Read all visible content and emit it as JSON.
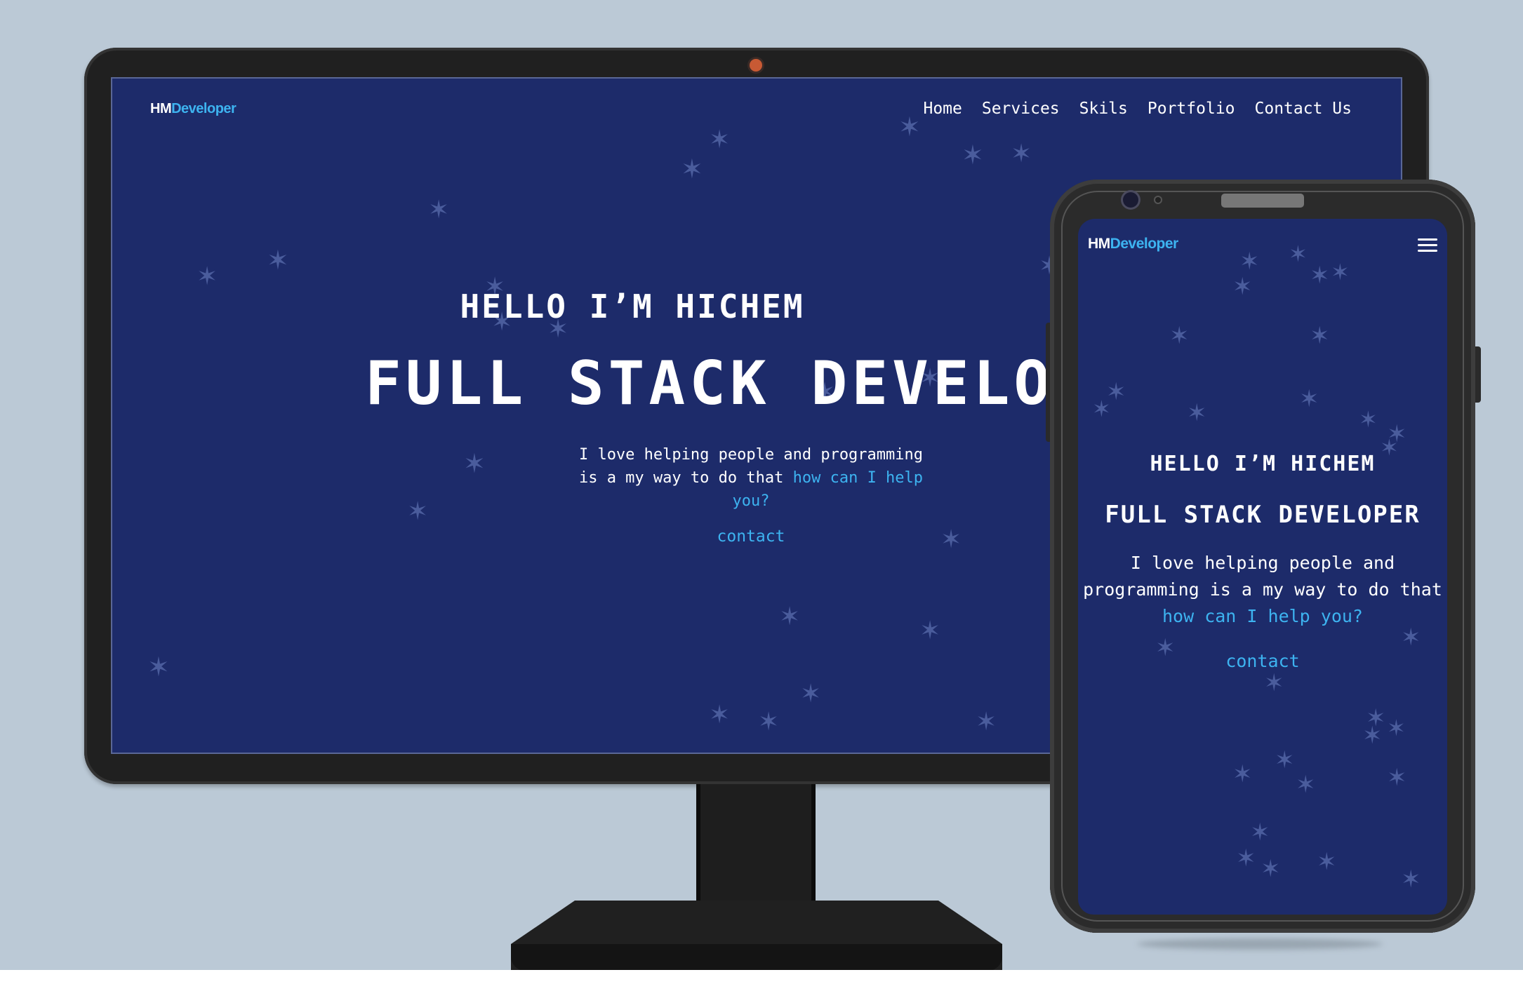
{
  "brand": {
    "hm": "HM",
    "developer": "Developer"
  },
  "desktop": {
    "nav": [
      "Home",
      "Services",
      "Skils",
      "Portfolio",
      "Contact Us"
    ],
    "hello": "HELLO I’M HICHEM",
    "title": "FULL STACK DEVELOPER",
    "desc_text": "I love helping people and programming is a my way to do that",
    "desc_link": "how can I help you?",
    "contact": "contact"
  },
  "mobile": {
    "hello": "HELLO I’M HICHEM",
    "title": "FULL STACK DEVELOPER",
    "desc_text": "I love helping people and programming is a my way to do that",
    "desc_link": "how can I help you?",
    "contact": "contact",
    "menu_icon": "hamburger-menu-icon"
  },
  "colors": {
    "background": "#bbc9d6",
    "screen": "#1d2b6a",
    "accent": "#3db3f0",
    "star": "#4a5c9c",
    "device": "#202020"
  }
}
